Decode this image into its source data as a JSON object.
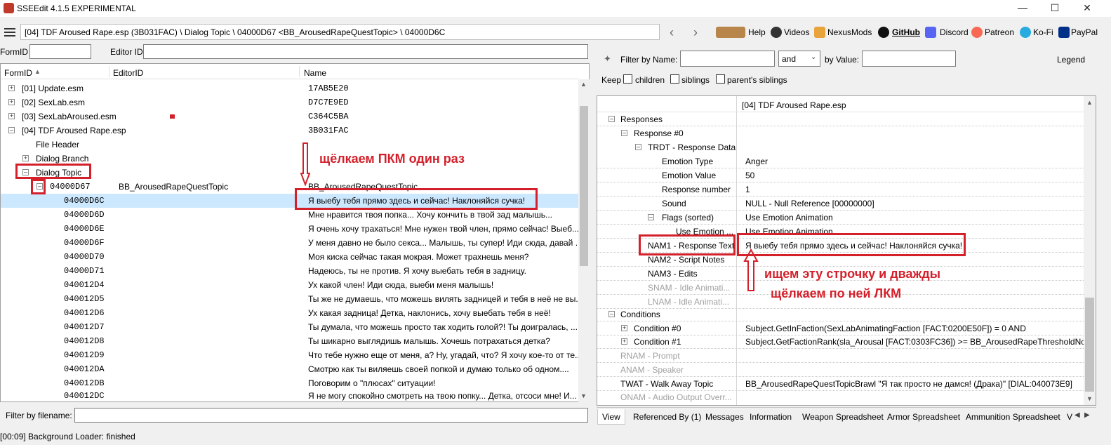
{
  "window": {
    "title": "SSEEdit 4.1.5 EXPERIMENTAL"
  },
  "toolbar": {
    "path": "[04] TDF Aroused Rape.esp (3B031FAC) \\ Dialog Topic \\ 04000D67 <BB_ArousedRapeQuestTopic> \\ 04000D6C",
    "links": [
      "Help",
      "Videos",
      "NexusMods",
      "GitHub",
      "Discord",
      "Patreon",
      "Ko-Fi",
      "PayPal"
    ]
  },
  "left": {
    "formid_label": "FormID",
    "editorid_label": "Editor ID",
    "columns": [
      "FormID",
      "EditorID",
      "Name"
    ],
    "tree": [
      {
        "id": "[01] Update.esm",
        "editor": "",
        "name": "17AB5E20"
      },
      {
        "id": "[02] SexLab.esm",
        "editor": "",
        "name": "D7C7E9ED"
      },
      {
        "id": "[03] SexLabAroused.esm",
        "editor": "",
        "name": "C364C5BA"
      },
      {
        "id": "[04] TDF Aroused Rape.esp",
        "editor": "",
        "name": "3B031FAC"
      },
      {
        "id": "File Header",
        "editor": "",
        "name": ""
      },
      {
        "id": "Dialog Branch",
        "editor": "",
        "name": ""
      },
      {
        "id": "Dialog Topic",
        "editor": "",
        "name": ""
      },
      {
        "id": "04000D67",
        "editor": "BB_ArousedRapeQuestTopic",
        "name": "BB_ArousedRapeQuestTopic"
      },
      {
        "id": "04000D6C",
        "editor": "",
        "name": "Я выебу тебя прямо здесь и сейчас! Наклоняйся сучка!"
      },
      {
        "id": "04000D6D",
        "editor": "",
        "name": "Мне нравится твоя попка... Хочу кончить в твой зад малышь..."
      },
      {
        "id": "04000D6E",
        "editor": "",
        "name": "Я очень хочу трахаться! Мне нужен твой член, прямо сейчас! Выеб..."
      },
      {
        "id": "04000D6F",
        "editor": "",
        "name": "У меня давно не было секса... Малышь, ты супер! Иди сюда, давай ..."
      },
      {
        "id": "04000D70",
        "editor": "",
        "name": "Моя киска сейчас такая мокрая. Может трахнешь меня?"
      },
      {
        "id": "04000D71",
        "editor": "",
        "name": "Надеюсь, ты не против. Я хочу выебать тебя в задницу."
      },
      {
        "id": "040012D4",
        "editor": "",
        "name": "Ух какой член! Иди сюда, выеби меня малышь!"
      },
      {
        "id": "040012D5",
        "editor": "",
        "name": "Ты же не думаешь, что можешь вилять задницей и тебя в неё не вы..."
      },
      {
        "id": "040012D6",
        "editor": "",
        "name": "Ух какая задница! Детка, наклонись, хочу выебать тебя в неё!"
      },
      {
        "id": "040012D7",
        "editor": "",
        "name": "Ты думала, что можешь просто так ходить голой?! Ты доигралась, ..."
      },
      {
        "id": "040012D8",
        "editor": "",
        "name": "Ты шикарно выглядишь малышь. Хочешь потрахаться детка?"
      },
      {
        "id": "040012D9",
        "editor": "",
        "name": "Что тебе нужно еще от меня, а? Ну, угадай, что? Я хочу кое-то от те..."
      },
      {
        "id": "040012DA",
        "editor": "",
        "name": "Смотрю как ты виляешь своей попкой и думаю только об одном...."
      },
      {
        "id": "040012DB",
        "editor": "",
        "name": "Поговорим о \"плюсах\" ситуации!"
      },
      {
        "id": "040012DC",
        "editor": "",
        "name": "Я не могу спокойно смотреть на твою попку... Детка, отсоси мне! И..."
      }
    ],
    "filter_label": "Filter by filename:"
  },
  "right": {
    "filter_name_label": "Filter by Name:",
    "and_value": "and",
    "by_value_label": "by Value:",
    "legend_label": "Legend",
    "keep_label": "Keep",
    "keep_options": [
      "children",
      "siblings",
      "parent's siblings"
    ],
    "header_value": "[04] TDF Aroused Rape.esp",
    "rows": [
      {
        "label": "Responses",
        "value": ""
      },
      {
        "label": "Response #0",
        "value": ""
      },
      {
        "label": "TRDT - Response Data",
        "value": ""
      },
      {
        "label": "Emotion Type",
        "value": "Anger"
      },
      {
        "label": "Emotion Value",
        "value": "50"
      },
      {
        "label": "Response number",
        "value": "1"
      },
      {
        "label": "Sound",
        "value": "NULL - Null Reference [00000000]"
      },
      {
        "label": "Flags (sorted)",
        "value": "Use Emotion Animation"
      },
      {
        "label": "Use Emotion ...",
        "value": "Use Emotion Animation"
      },
      {
        "label": "NAM1 - Response Text",
        "value": "Я выебу тебя прямо здесь и сейчас! Наклоняйся сучка!"
      },
      {
        "label": "NAM2 - Script Notes",
        "value": ""
      },
      {
        "label": "NAM3 - Edits",
        "value": ""
      },
      {
        "label": "SNAM - Idle Animati...",
        "value": ""
      },
      {
        "label": "LNAM - Idle Animati...",
        "value": ""
      },
      {
        "label": "Conditions",
        "value": ""
      },
      {
        "label": "Condition #0",
        "value": "Subject.GetInFaction(SexLabAnimatingFaction [FACT:0200E50F]) = 0 AND"
      },
      {
        "label": "Condition #1",
        "value": "Subject.GetFactionRank(sla_Arousal [FACT:0303FC36]) >= BB_ArousedRapeThresholdNor..."
      },
      {
        "label": "RNAM - Prompt",
        "value": ""
      },
      {
        "label": "ANAM - Speaker",
        "value": ""
      },
      {
        "label": "TWAT - Walk Away Topic",
        "value": "BB_ArousedRapeQuestTopicBrawl \"Я так просто не дамся! (Драка)\" [DIAL:040073E9]"
      },
      {
        "label": "ONAM - Audio Output Overr...",
        "value": ""
      }
    ],
    "tabs": [
      "View",
      "Referenced By (1)",
      "Messages",
      "Information",
      "Weapon Spreadsheet",
      "Armor Spreadsheet",
      "Ammunition Spreadsheet",
      "V"
    ]
  },
  "annotations": {
    "right_click_once": "щёлкаем ПКМ один раз",
    "find_line_line1": "ищем эту строчку и дважды",
    "find_line_line2": "щёлкаем по ней ЛКМ",
    "annotation_color": "#d4202b"
  },
  "status": {
    "text": "[00:09] Background Loader: finished"
  }
}
